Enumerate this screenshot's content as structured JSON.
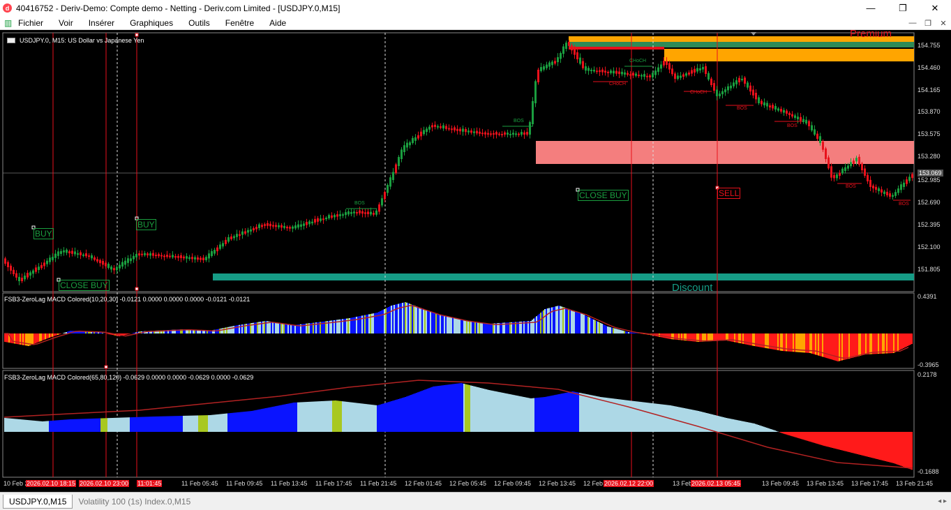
{
  "window": {
    "title": "40416752 - Deriv-Demo: Compte demo - Netting - Deriv.com Limited - [USDJPY.0,M15]",
    "icon": "deriv-logo-icon",
    "minimize": "—",
    "maximize": "❐",
    "close": "✕"
  },
  "menu": {
    "items": [
      "Fichier",
      "Voir",
      "Insérer",
      "Graphiques",
      "Outils",
      "Fenêtre",
      "Aide"
    ],
    "mdi_minimize": "—",
    "mdi_restore": "❐",
    "mdi_close": "✕"
  },
  "chart": {
    "symbol_title": "USDJPY.0, M15:  US Dollar vs Japanese Yen",
    "price_axis": [
      "154.755",
      "154.460",
      "154.165",
      "153.870",
      "153.575",
      "153.280",
      "152.985",
      "152.690",
      "152.395",
      "152.100",
      "151.805"
    ],
    "current_price": "153.069",
    "annotations": {
      "buy1": "BUY",
      "buy2": "BUY",
      "close_buy1": "CLOSE BUY",
      "close_buy2": "CLOSE BUY",
      "sell": "SELL",
      "premium": "Premium",
      "discount": "Discount",
      "bos": "BOS",
      "choch": "CHoCH"
    },
    "colors": {
      "bull": "#1a9e3f",
      "bear": "#e8111b",
      "premium_zone": "#ffa500",
      "supply_zone": "#f47e7e",
      "discount_zone": "#169c86",
      "green_band": "#2e8b57"
    }
  },
  "indicator1": {
    "title": "FSB3-ZeroLag MACD Colored(10,20,30) -0.0121 0.0000 0.0000 0.0000 -0.0121 -0.0121",
    "max": "0.4391",
    "min": "-0.3965"
  },
  "indicator2": {
    "title": "FSB3-ZeroLag MACD Colored(65,80,120) -0.0629 0.0000 0.0000 -0.0629 0.0000 -0.0629",
    "max": "0.2178",
    "min": "-0.1688"
  },
  "time_axis": [
    {
      "label": "10 Feb 2026",
      "red": false
    },
    {
      "label": "2026.02.10 18:15",
      "red": true
    },
    {
      "label": "2026.02.10 23:00",
      "red": true
    },
    {
      "label": "11:01:45",
      "red": true
    },
    {
      "label": "11 Feb 05:45",
      "red": false
    },
    {
      "label": "11 Feb 09:45",
      "red": false
    },
    {
      "label": "11 Feb 13:45",
      "red": false
    },
    {
      "label": "11 Feb 17:45",
      "red": false
    },
    {
      "label": "11 Feb 21:45",
      "red": false
    },
    {
      "label": "12 Feb 01:45",
      "red": false
    },
    {
      "label": "12 Feb 05:45",
      "red": false
    },
    {
      "label": "12 Feb 09:45",
      "red": false
    },
    {
      "label": "12 Feb 13:45",
      "red": false
    },
    {
      "label": "12 Feb",
      "red": false
    },
    {
      "label": "2026.02.12 22:00",
      "red": true
    },
    {
      "label": "13 Feb",
      "red": false
    },
    {
      "label": "2026.02.13 05:45",
      "red": true
    },
    {
      "label": "13 Feb 09:45",
      "red": false
    },
    {
      "label": "13 Feb 13:45",
      "red": false
    },
    {
      "label": "13 Feb 17:45",
      "red": false
    },
    {
      "label": "13 Feb 21:45",
      "red": false
    }
  ],
  "tabs": {
    "items": [
      "USDJPY.0,M15",
      "Volatility 100 (1s) Index.0,M15"
    ],
    "arrows": "◂ ▸"
  }
}
